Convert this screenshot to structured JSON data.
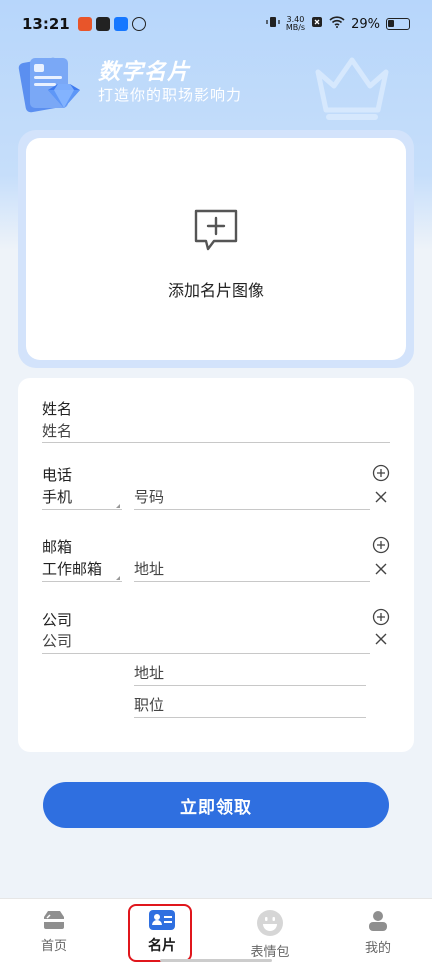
{
  "status_bar": {
    "time": "13:21",
    "speed_value": "3.40",
    "speed_unit": "MB/s",
    "battery": "29%"
  },
  "brand": {
    "title": "数字名片",
    "subtitle": "打造你的职场影响力"
  },
  "upload": {
    "label": "添加名片图像"
  },
  "form": {
    "name": {
      "label": "姓名",
      "placeholder": "姓名"
    },
    "phone": {
      "label": "电话",
      "type": "手机",
      "placeholder": "号码"
    },
    "email": {
      "label": "邮箱",
      "type": "工作邮箱",
      "placeholder": "地址"
    },
    "company": {
      "label": "公司",
      "placeholder": "公司",
      "address_placeholder": "地址",
      "position_placeholder": "职位"
    }
  },
  "claim_button": {
    "label": "立即领取"
  },
  "bottom_nav": [
    {
      "label": "首页",
      "icon": "home-icon",
      "active": false
    },
    {
      "label": "名片",
      "icon": "card-icon",
      "active": true
    },
    {
      "label": "表情包",
      "icon": "smiley-icon",
      "active": false
    },
    {
      "label": "我的",
      "icon": "person-icon",
      "active": false
    }
  ],
  "colors": {
    "accent": "#2f6fe0",
    "highlight": "#e0161c",
    "header_bg": "#b7d6fb"
  }
}
